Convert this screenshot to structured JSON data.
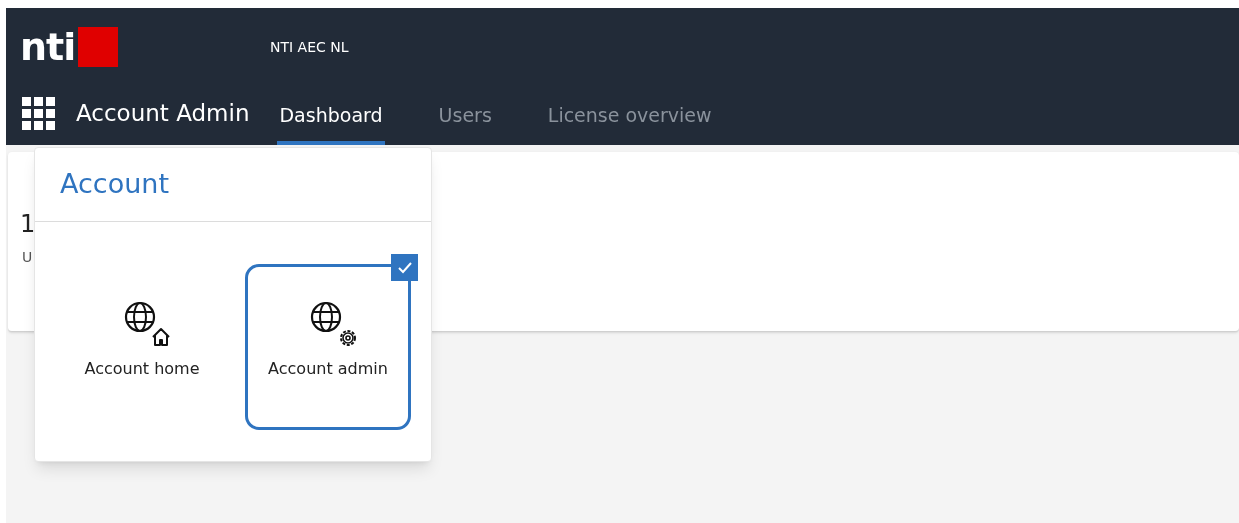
{
  "header": {
    "logo": "nti",
    "account_name": "NTI AEC NL",
    "app_title": "Account Admin"
  },
  "tabs": [
    {
      "label": "Dashboard",
      "selected": true
    },
    {
      "label": "Users",
      "selected": false
    },
    {
      "label": "License overview",
      "selected": false
    }
  ],
  "card": {
    "value": "1",
    "label": "U"
  },
  "app_menu": {
    "title": "Account",
    "items": [
      {
        "label": "Account home",
        "kind": "home",
        "selected": false
      },
      {
        "label": "Account admin",
        "kind": "admin",
        "selected": true
      }
    ]
  }
}
